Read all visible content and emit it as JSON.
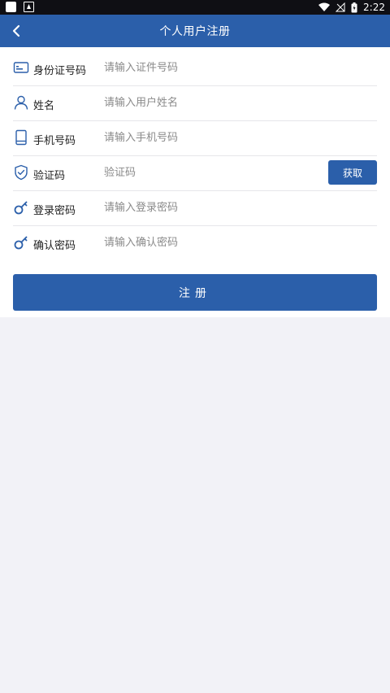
{
  "status_bar": {
    "time": "2:22"
  },
  "header": {
    "title": "个人用户注册"
  },
  "form": {
    "rows": [
      {
        "label": "身份证号码",
        "placeholder": "请输入证件号码",
        "icon": "id-card-icon"
      },
      {
        "label": "姓名",
        "placeholder": "请输入用户姓名",
        "icon": "person-icon"
      },
      {
        "label": "手机号码",
        "placeholder": "请输入手机号码",
        "icon": "phone-icon"
      },
      {
        "label": "验证码",
        "placeholder": "验证码",
        "icon": "shield-icon"
      },
      {
        "label": "登录密码",
        "placeholder": "请输入登录密码",
        "icon": "key-icon"
      },
      {
        "label": "确认密码",
        "placeholder": "请输入确认密码",
        "icon": "key-icon"
      }
    ],
    "get_code_label": "获取",
    "submit_label": "注册"
  },
  "colors": {
    "primary": "#2b5faa",
    "page_bg": "#f2f2f7",
    "status_bar": "#0f0f14"
  }
}
